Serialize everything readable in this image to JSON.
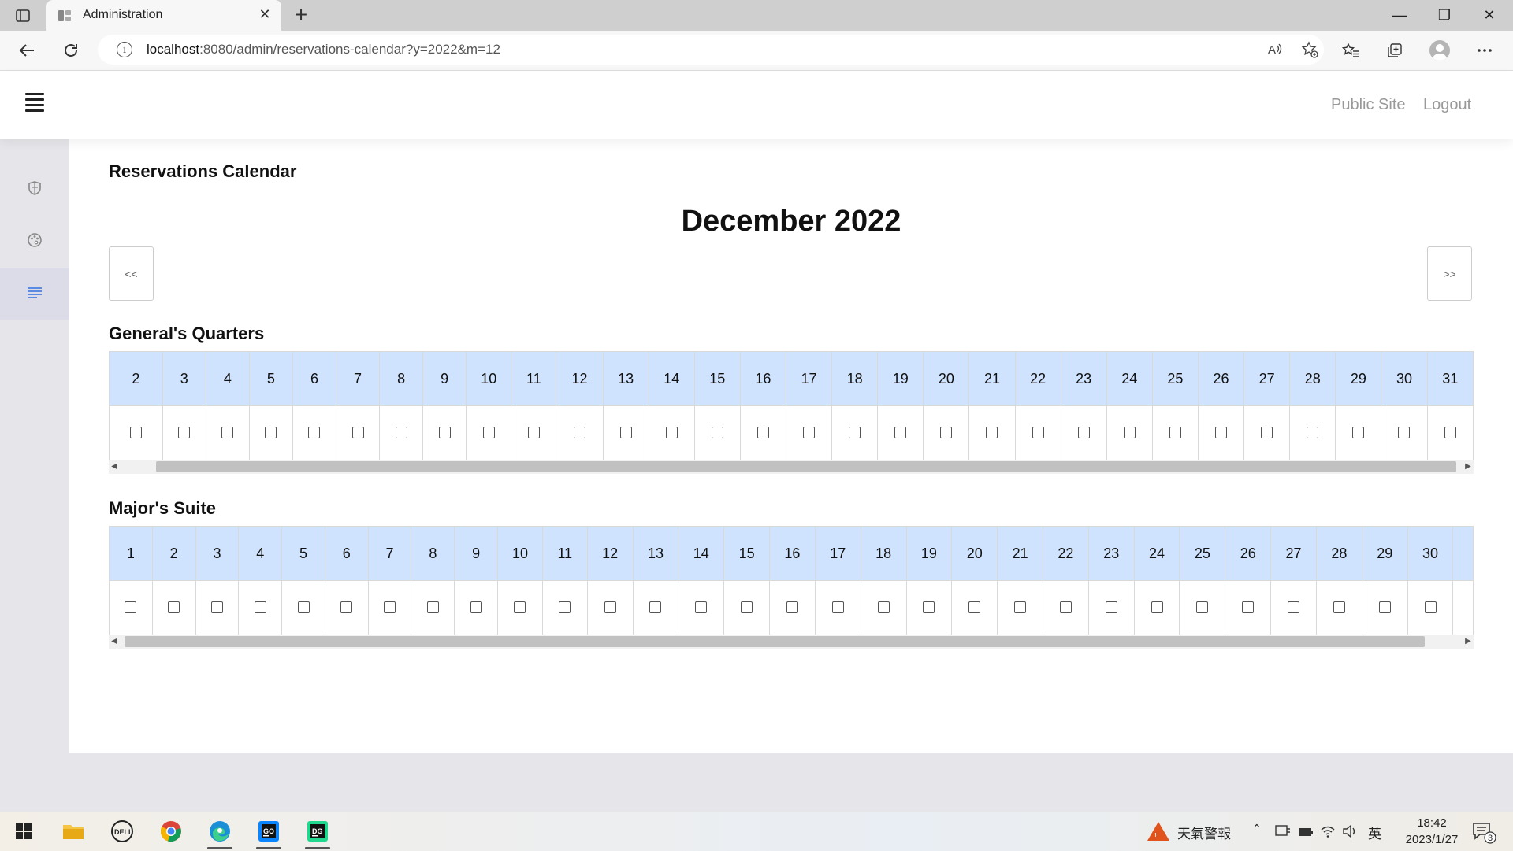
{
  "browser": {
    "tab_title": "Administration",
    "tab_close": "✕",
    "new_tab": "+",
    "url_host": "localhost",
    "url_rest": ":8080/admin/reservations-calendar?y=2022&m=12",
    "window_controls": {
      "minimize": "—",
      "restore": "❐",
      "close": "✕"
    }
  },
  "header": {
    "links": [
      "Public Site",
      "Logout"
    ]
  },
  "sidebar": {
    "items": [
      {
        "icon": "shield-icon"
      },
      {
        "icon": "palette-icon"
      },
      {
        "icon": "menu-lines-icon",
        "active": true
      }
    ]
  },
  "page": {
    "title": "Reservations Calendar",
    "month_title": "December 2022",
    "prev_label": "<<",
    "next_label": ">>"
  },
  "rooms": [
    {
      "name": "General's Quarters",
      "days": [
        "2",
        "3",
        "4",
        "5",
        "6",
        "7",
        "8",
        "9",
        "10",
        "11",
        "12",
        "13",
        "14",
        "15",
        "16",
        "17",
        "18",
        "19",
        "20",
        "21",
        "22",
        "23",
        "24",
        "25",
        "26",
        "27",
        "28",
        "29",
        "30",
        "31"
      ]
    },
    {
      "name": "Major's Suite",
      "days": [
        "1",
        "2",
        "3",
        "4",
        "5",
        "6",
        "7",
        "8",
        "9",
        "10",
        "11",
        "12",
        "13",
        "14",
        "15",
        "16",
        "17",
        "18",
        "19",
        "20",
        "21",
        "22",
        "23",
        "24",
        "25",
        "26",
        "27",
        "28",
        "29",
        "30"
      ]
    }
  ],
  "taskbar": {
    "weather_label": "天氣警報",
    "ime": "英",
    "time": "18:42",
    "date": "2023/1/27",
    "notification_count": "3"
  },
  "colors": {
    "day_header_bg": "#cfe3fe",
    "sidebar_active": "#2f6fe0"
  }
}
